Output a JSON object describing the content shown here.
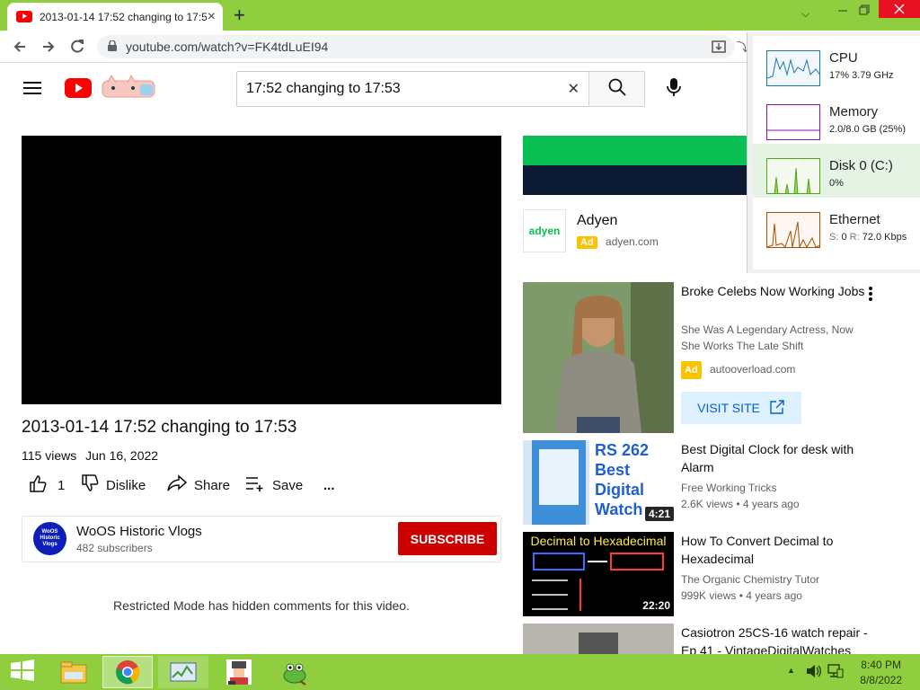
{
  "browser": {
    "tab_title": "2013-01-14 17:52 changing to 17:53",
    "tab_close": "×",
    "new_tab": "+",
    "url": "youtube.com/watch?v=FK4tdLuEI94"
  },
  "youtube": {
    "search_value": "17:52 changing to 17:53",
    "search_clear": "✕"
  },
  "video": {
    "title": "2013-01-14 17:52 changing to 17:53",
    "views": "115 views",
    "date": "Jun 16, 2022",
    "likes": "1",
    "dislike_label": "Dislike",
    "share_label": "Share",
    "save_label": "Save",
    "more_label": "...",
    "restricted_notice": "Restricted Mode has hidden comments for this video."
  },
  "channel": {
    "name": "WoOS Historic Vlogs",
    "subscribers": "482 subscribers",
    "avatar_text": "WoOS Historic Vlogs",
    "subscribe_label": "SUBSCRIBE"
  },
  "ad_top": {
    "brand": "Adyen",
    "logo_text": "adyen",
    "badge": "Ad",
    "domain": "adyen.com"
  },
  "ad_side": {
    "title": "Broke Celebs Now Working Jobs",
    "desc": "She Was A Legendary Actress, Now She Works The Late Shift",
    "badge": "Ad",
    "domain": "autooverload.com",
    "cta": "VISIT SITE"
  },
  "related": [
    {
      "title": "Best Digital Clock for desk with Alarm",
      "channel": "Free Working Tricks",
      "meta": "2.6K views • 4 years ago",
      "duration": "4:21",
      "thumb_text": "RS 262 Best Digital Watch"
    },
    {
      "title": "How To Convert Decimal to Hexadecimal",
      "channel": "The Organic Chemistry Tutor",
      "meta": "999K views • 4 years ago",
      "duration": "22:20",
      "thumb_text": "Decimal to Hexadecimal"
    },
    {
      "title": "Casiotron 25CS-16 watch repair - Ep 41 - VintageDigitalWatches"
    }
  ],
  "task_manager": {
    "cpu": {
      "name": "CPU",
      "value": "17% 3.79 GHz"
    },
    "memory": {
      "name": "Memory",
      "value": "2.0/8.0 GB (25%)"
    },
    "disk": {
      "name": "Disk 0 (C:)",
      "value": "0%"
    },
    "ethernet": {
      "name": "Ethernet",
      "value_s": "S:",
      "value_s_num": "0",
      "value_r": "R:",
      "value_r_num": "72.0 Kbps"
    }
  },
  "taskbar": {
    "time": "8:40 PM",
    "date": "8/8/2022"
  },
  "colors": {
    "accent_green": "#8fce3e",
    "youtube_red": "#ff0000",
    "subscribe_red": "#cc0000",
    "ad_yellow": "#f9c300",
    "visit_blue": "#065fd4"
  }
}
